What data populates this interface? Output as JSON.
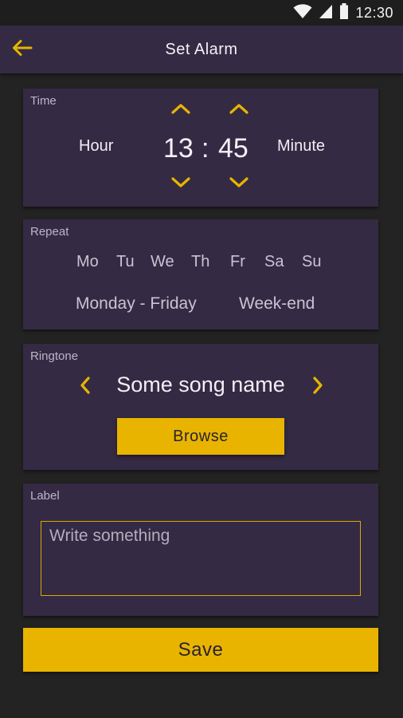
{
  "status_bar": {
    "time": "12:30",
    "icons": [
      "wifi-icon",
      "signal-icon",
      "battery-icon"
    ]
  },
  "app_bar": {
    "title": "Set Alarm",
    "back_icon": "arrow-left-icon"
  },
  "time_section": {
    "label": "Time",
    "hour_label": "Hour",
    "minute_label": "Minute",
    "hour": "13",
    "separator": ":",
    "minute": "45"
  },
  "repeat_section": {
    "label": "Repeat",
    "days": [
      "Mo",
      "Tu",
      "We",
      "Th",
      "Fr",
      "Sa",
      "Su"
    ],
    "options": [
      "Monday - Friday",
      "Week-end"
    ]
  },
  "ringtone_section": {
    "label": "Ringtone",
    "song_name": "Some song name",
    "browse_label": "Browse"
  },
  "label_section": {
    "label": "Label",
    "placeholder": "Write something",
    "value": ""
  },
  "save_label": "Save",
  "colors": {
    "accent": "#e8b400",
    "card": "#342a43",
    "background": "#232323"
  }
}
